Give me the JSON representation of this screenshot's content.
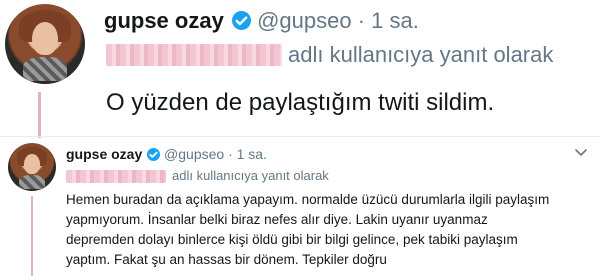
{
  "main_tweet": {
    "name": "gupse ozay",
    "handle": "@gupseo",
    "time": "· 1 sa.",
    "reply_label": "adlı kullanıcıya yanıt olarak",
    "text": "O yüzden de paylaştığım twiti sildim."
  },
  "quoted_tweet": {
    "name": "gupse ozay",
    "handle": "@gupseo",
    "time": "· 1 sa.",
    "reply_label": "adlı kullanıcıya yanıt olarak",
    "lines": [
      "Hemen buradan da açıklama yapayım. normalde üzücü durumlarla ilgili paylaşım",
      "yapmıyorum. İnsanlar belki biraz nefes alır diye. Lakin uyanır uyanmaz",
      "depremden dolayı binlerce kişi öldü gibi bir bilgi gelince, pek tabiki paylaşım",
      "yaptım. Fakat şu an hassas bir dönem. Tepkiler doğru"
    ]
  },
  "colors": {
    "verified": "#1da1f2",
    "thread_line": "#e2b2be",
    "censor": "#f2bfcd"
  }
}
